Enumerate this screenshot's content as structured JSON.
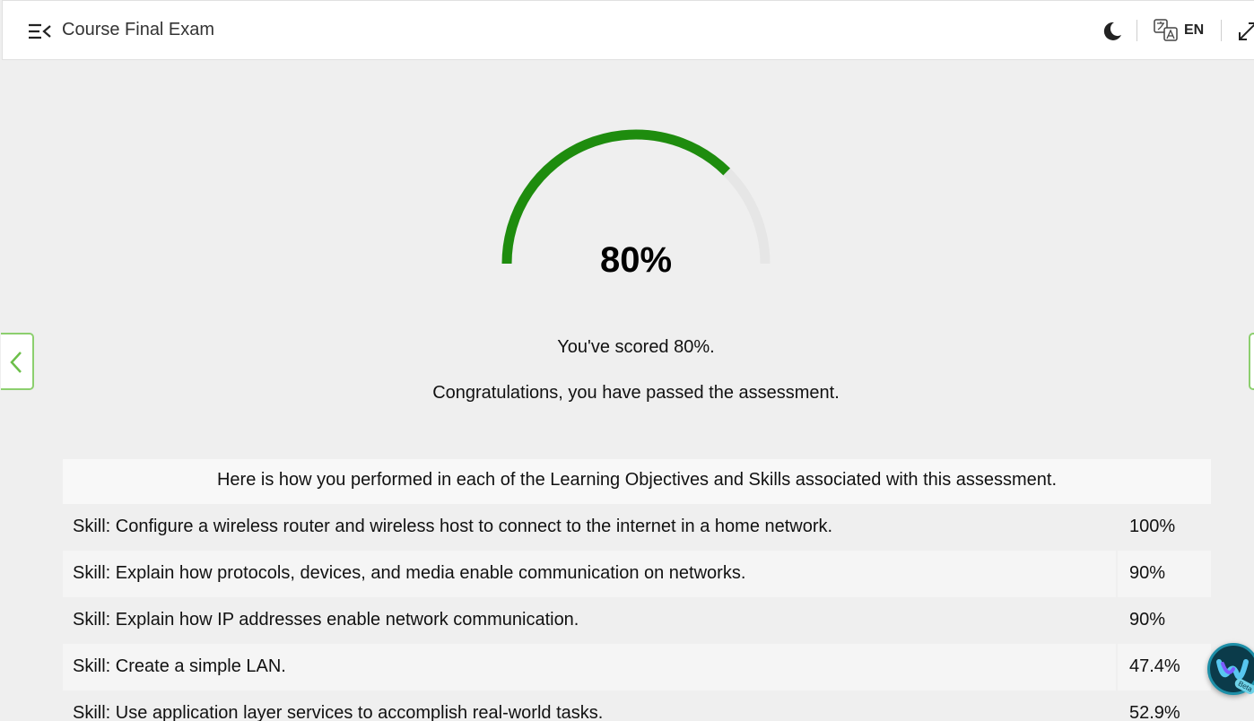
{
  "header": {
    "title": "Course Final Exam",
    "language": "EN"
  },
  "gauge": {
    "percent": 80,
    "label": "80%",
    "color": "#1e8c0e",
    "track_color": "#e6e6e6"
  },
  "result": {
    "scored_text": "You've scored 80%.",
    "passed_text": "Congratulations, you have passed the assessment."
  },
  "table": {
    "header": "Here is how you performed in each of the Learning Objectives and Skills associated with this assessment.",
    "rows": [
      {
        "skill": "Skill: Configure a wireless router and wireless host to connect to the internet in a home network.",
        "score": "100%"
      },
      {
        "skill": "Skill: Explain how protocols, devices, and media enable communication on networks.",
        "score": "90%"
      },
      {
        "skill": "Skill: Explain how IP addresses enable network communication.",
        "score": "90%"
      },
      {
        "skill": "Skill: Create a simple LAN.",
        "score": "47.4%"
      },
      {
        "skill": "Skill: Use application layer services to accomplish real-world tasks.",
        "score": "52.9%"
      }
    ]
  },
  "icons": {
    "menu": "menu-collapse-icon",
    "theme": "moon-icon",
    "translate": "translate-icon",
    "expand": "expand-icon",
    "prev": "chevron-left-icon",
    "assistant": "webex-icon"
  },
  "webex": {
    "badge": "Beta"
  },
  "colors": {
    "accent_green": "#1e8c0e",
    "nav_border": "#8ccf6e",
    "background": "#efefef"
  }
}
